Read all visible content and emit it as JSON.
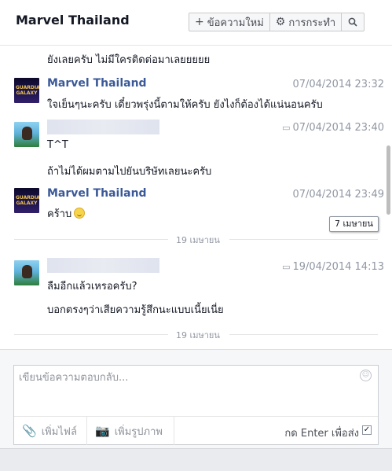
{
  "header": {
    "title": "Marvel Thailand",
    "new_message_label": "ข้อความใหม่",
    "actions_label": "การกระทำ"
  },
  "messages": {
    "line0": "ยังเลยครับ ไม่มีใครติดต่อมาเลยยยยย",
    "msg1": {
      "sender": "Marvel Thailand",
      "time": "07/04/2014 23:32",
      "text": "ใจเย็นๆนะครับ เดี๋ยวพรุ่งนี้ตามให้ครับ ยังไงก็ต้องได้แน่นอนครับ"
    },
    "msg2": {
      "time": "07/04/2014 23:40",
      "text1": "T^T",
      "text2": "ถ้าไม่ได้ผมตามไปยันบริษัทเลยนะครับ"
    },
    "msg3": {
      "sender": "Marvel Thailand",
      "time": "07/04/2014 23:49",
      "text": "คร้าบ"
    },
    "tooltip": "7 เมษายน",
    "divider1": "19 เมษายน",
    "msg4": {
      "time": "19/04/2014 14:13",
      "text1": "ลืมอีกแล้วเหรอครับ?",
      "text2": "บอกตรงๆว่าเสียความรู้สึกนะแบบเนี้ยเนี่ย"
    },
    "divider2": "19 เมษายน"
  },
  "composer": {
    "placeholder": "เขียนข้อความตอบกลับ...",
    "add_file_label": "เพิ่มไฟล์",
    "add_photo_label": "เพิ่มรูปภาพ",
    "enter_to_send_label": "กด Enter เพื่อส่ง",
    "enter_to_send_checked": true
  },
  "icons": {
    "new_message": "plus-icon",
    "actions": "gear-icon",
    "search": "search-icon",
    "reply": "reply-icon",
    "emoji": "emoji-icon",
    "attach": "paperclip-icon",
    "photo": "camera-icon"
  }
}
